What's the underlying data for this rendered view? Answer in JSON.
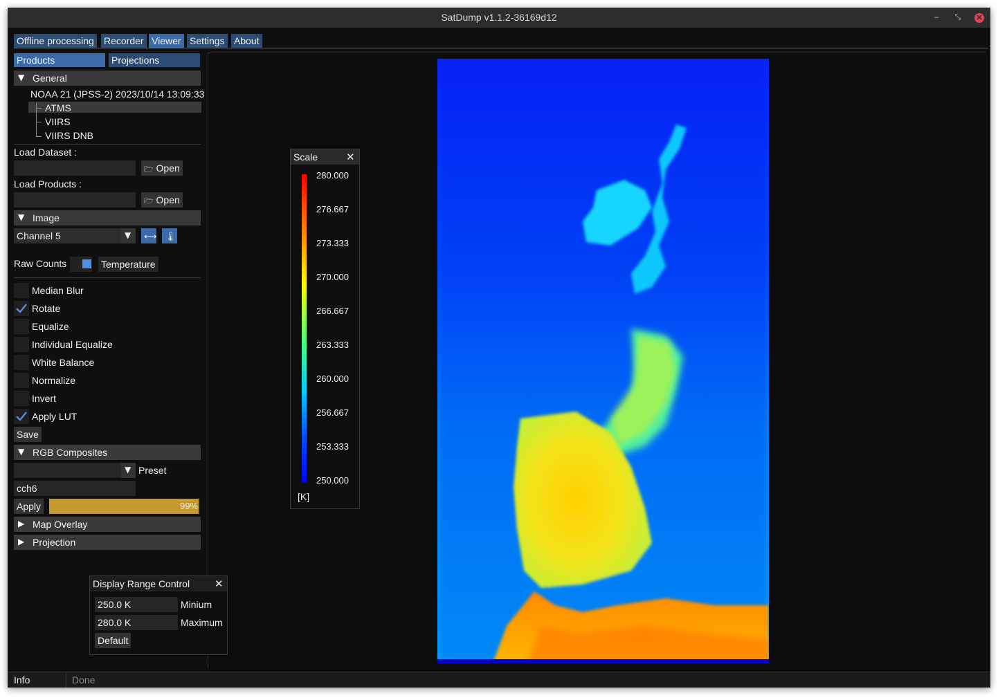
{
  "window": {
    "title": "SatDump v1.1.2-36169d12"
  },
  "tabs": [
    "Offline processing",
    "Recorder",
    "Viewer",
    "Settings",
    "About"
  ],
  "subtabs": [
    "Products",
    "Projections"
  ],
  "general": {
    "header": "General",
    "dataset": "NOAA 21 (JPSS-2) 2023/10/14 13:09:33",
    "products": [
      "ATMS",
      "VIIRS",
      "VIIRS DNB"
    ]
  },
  "load": {
    "dataset_label": "Load Dataset :",
    "products_label": "Load Products :",
    "open_label": "Open",
    "dataset_path": "",
    "products_path": ""
  },
  "image": {
    "header": "Image",
    "channel": "Channel 5",
    "raw_counts_label": "Raw Counts",
    "temperature_label": "Temperature",
    "options": [
      {
        "label": "Median Blur",
        "checked": false
      },
      {
        "label": "Rotate",
        "checked": true
      },
      {
        "label": "Equalize",
        "checked": false
      },
      {
        "label": "Individual Equalize",
        "checked": false
      },
      {
        "label": "White Balance",
        "checked": false
      },
      {
        "label": "Normalize",
        "checked": false
      },
      {
        "label": "Invert",
        "checked": false
      },
      {
        "label": "Apply LUT",
        "checked": true
      }
    ],
    "save_label": "Save"
  },
  "rgb": {
    "header": "RGB Composites",
    "preset_label": "Preset",
    "preset_value": "",
    "expression": "cch6",
    "apply_label": "Apply",
    "progress_text": "99%",
    "progress": 0.99
  },
  "map_overlay": {
    "header": "Map Overlay"
  },
  "projection": {
    "header": "Projection"
  },
  "scale": {
    "title": "Scale",
    "ticks": [
      "280.000",
      "276.667",
      "273.333",
      "270.000",
      "266.667",
      "263.333",
      "260.000",
      "256.667",
      "253.333",
      "250.000"
    ],
    "unit": "[K]"
  },
  "range": {
    "title": "Display Range Control",
    "min_value": "250.0 K",
    "min_label": "Minium",
    "max_value": "280.0 K",
    "max_label": "Maximum",
    "default_label": "Default"
  },
  "status": {
    "label": "Info",
    "text": "Done"
  },
  "colors": {
    "accent": "#3b6aa8",
    "tab": "#2c4b73",
    "progress": "#c49a2e",
    "check": "#4f8fe6"
  },
  "icons": [
    "folder-icon",
    "arrows-horizontal-icon",
    "thermometer-icon",
    "close-icon",
    "checkmark-icon",
    "chevron-down-icon"
  ]
}
